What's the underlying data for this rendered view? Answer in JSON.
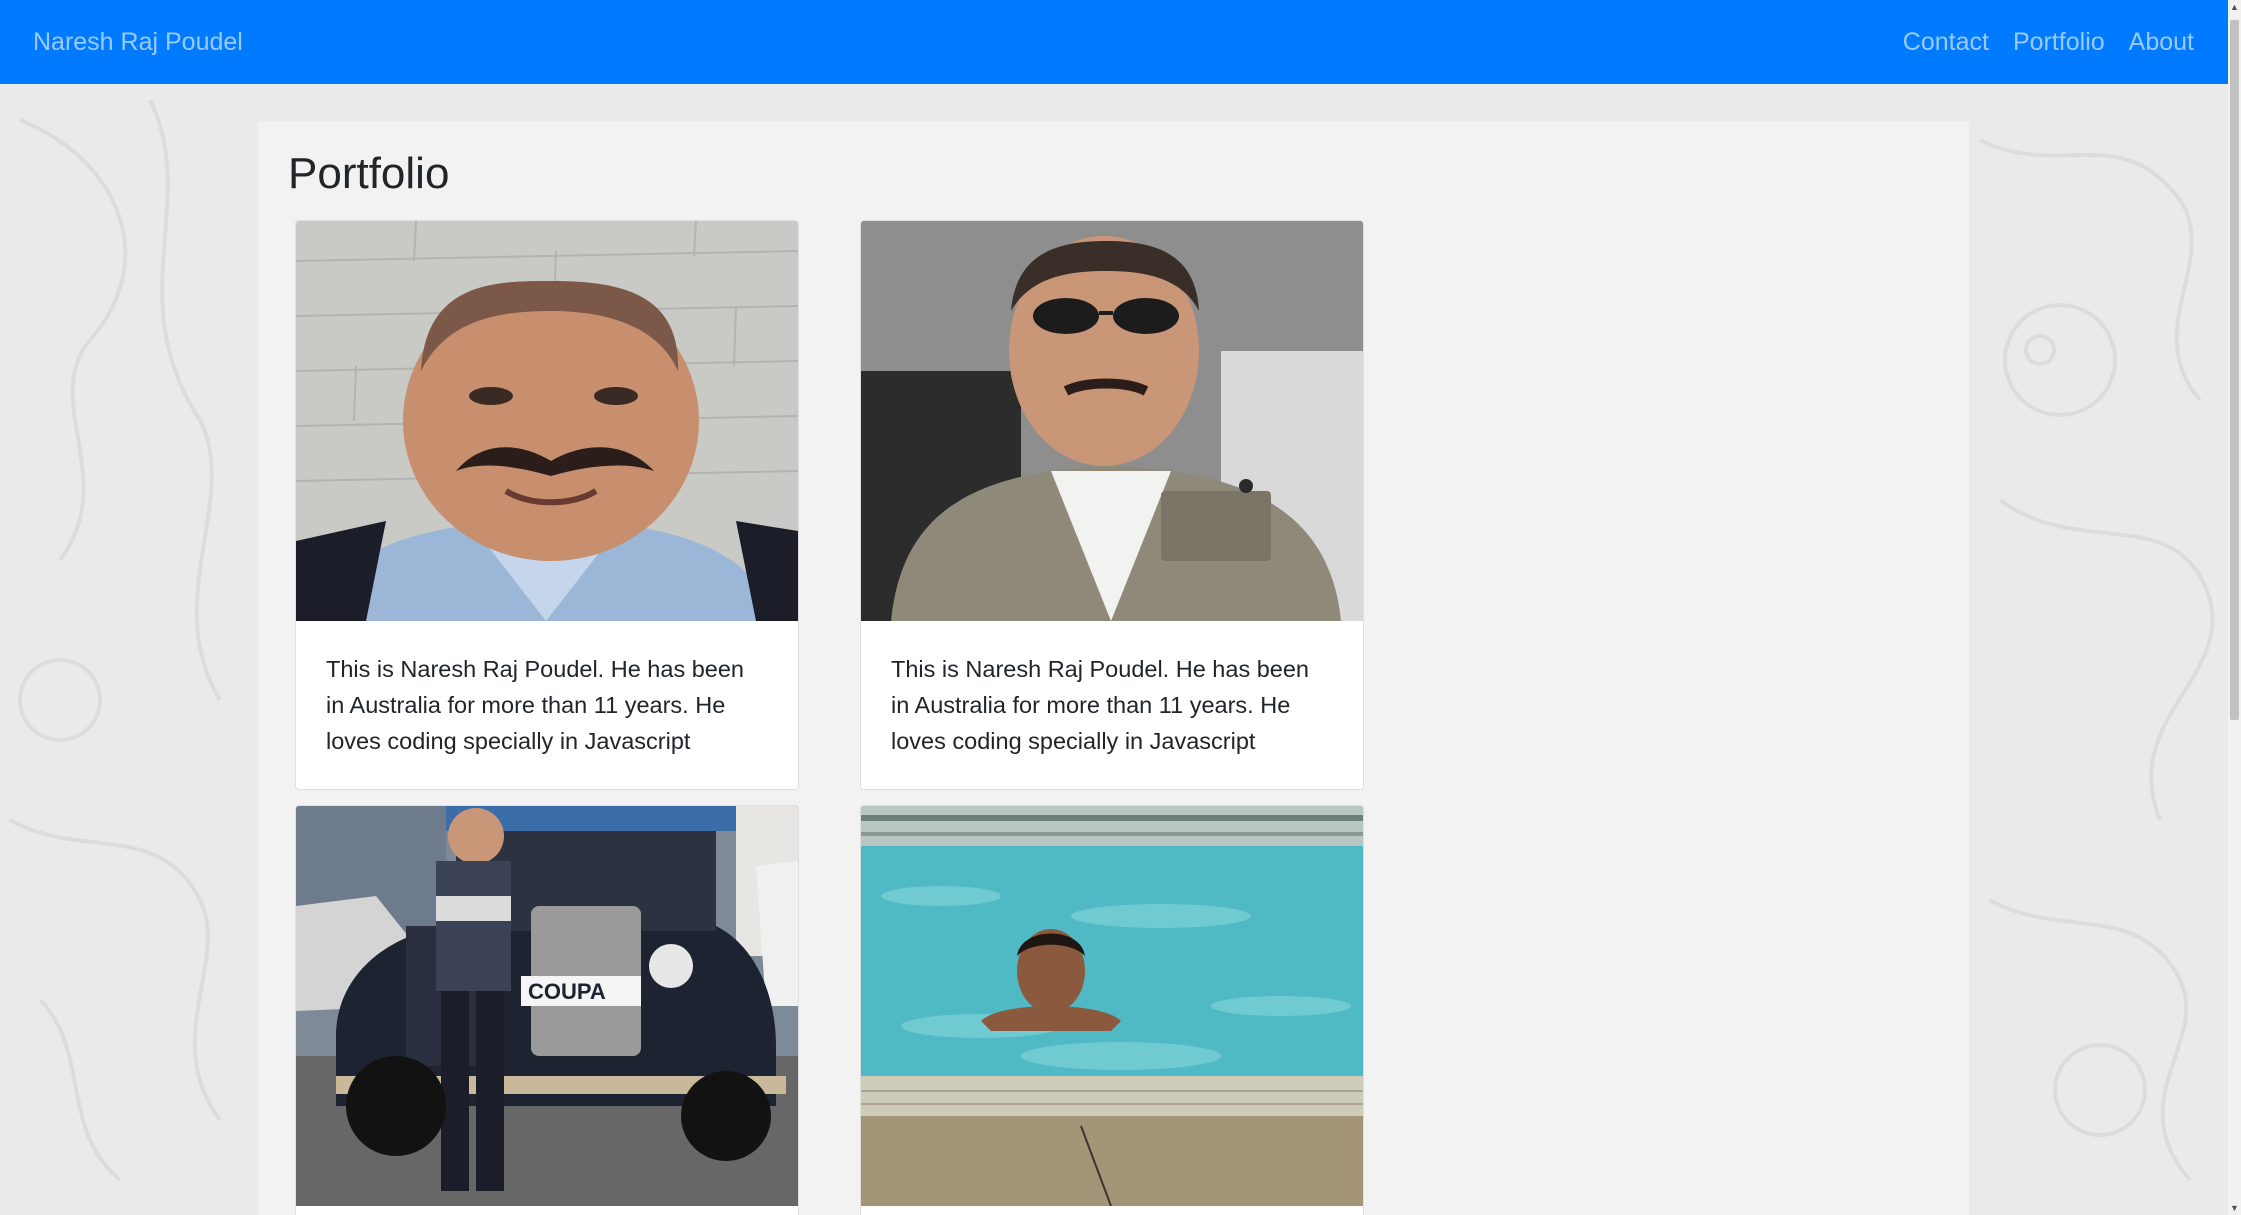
{
  "navbar": {
    "brand": "Naresh Raj Poudel",
    "links": [
      "Contact",
      "Portfolio",
      "About"
    ]
  },
  "page": {
    "title": "Portfolio"
  },
  "cards": [
    {
      "image": "portrait-selfie-photo",
      "text": "This is Naresh Raj Poudel. He has been in Australia for more than 11 years. He loves coding specially in Javascript"
    },
    {
      "image": "sunglasses-jacket-photo",
      "text": "This is Naresh Raj Poudel. He has been in Australia for more than 11 years. He loves coding specially in Javascript"
    },
    {
      "image": "vintage-car-photo",
      "plate": "COUPA"
    },
    {
      "image": "swimming-pool-photo"
    }
  ],
  "colors": {
    "navbar": "#007bff",
    "page_bg": "#eaeaea",
    "container_bg": "#f2f2f2",
    "text": "#212529"
  }
}
